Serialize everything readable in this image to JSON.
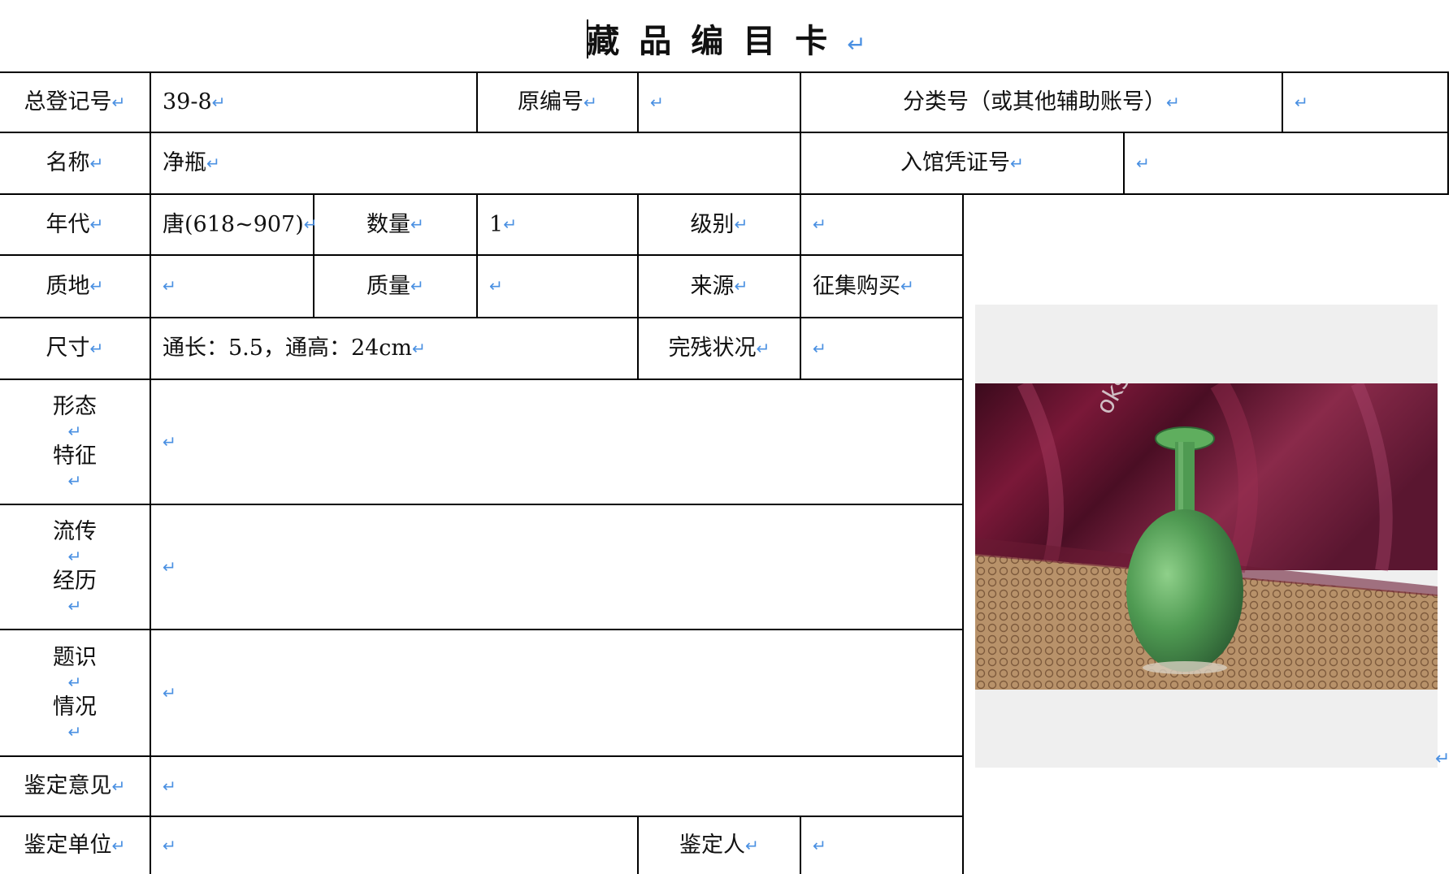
{
  "title": "藏品编目卡",
  "return_mark": "↵",
  "rows": {
    "reg_no_label": "总登记号",
    "reg_no": "39-8",
    "orig_no_label": "原编号",
    "orig_no": "",
    "class_no_label": "分类号（或其他辅助账号）",
    "class_no": "",
    "name_label": "名称",
    "name": "净瓶",
    "voucher_label": "入馆凭证号",
    "voucher": "",
    "era_label": "年代",
    "era": "唐(618~907)",
    "qty_label": "数量",
    "qty": "1",
    "grade_label": "级别",
    "grade": "",
    "material_label": "质地",
    "material": "",
    "weight_label": "质量",
    "weight": "",
    "source_label": "来源",
    "source": "征集购买",
    "size_label": "尺寸",
    "size": "通长：5.5，通高：24cm",
    "condition_label": "完残状况",
    "condition": "",
    "form_label_1": "形态",
    "form_label_2": "特征",
    "form": "",
    "history_label_1": "流传",
    "history_label_2": "经历",
    "history": "",
    "inscription_label_1": "题识",
    "inscription_label_2": "情况",
    "inscription": "",
    "opinion_label": "鉴定意见",
    "opinion": "",
    "unit_label": "鉴定单位",
    "unit": "",
    "appraiser_label": "鉴定人",
    "appraiser": ""
  },
  "photo": {
    "subject": "green-glazed-vase-photo"
  }
}
